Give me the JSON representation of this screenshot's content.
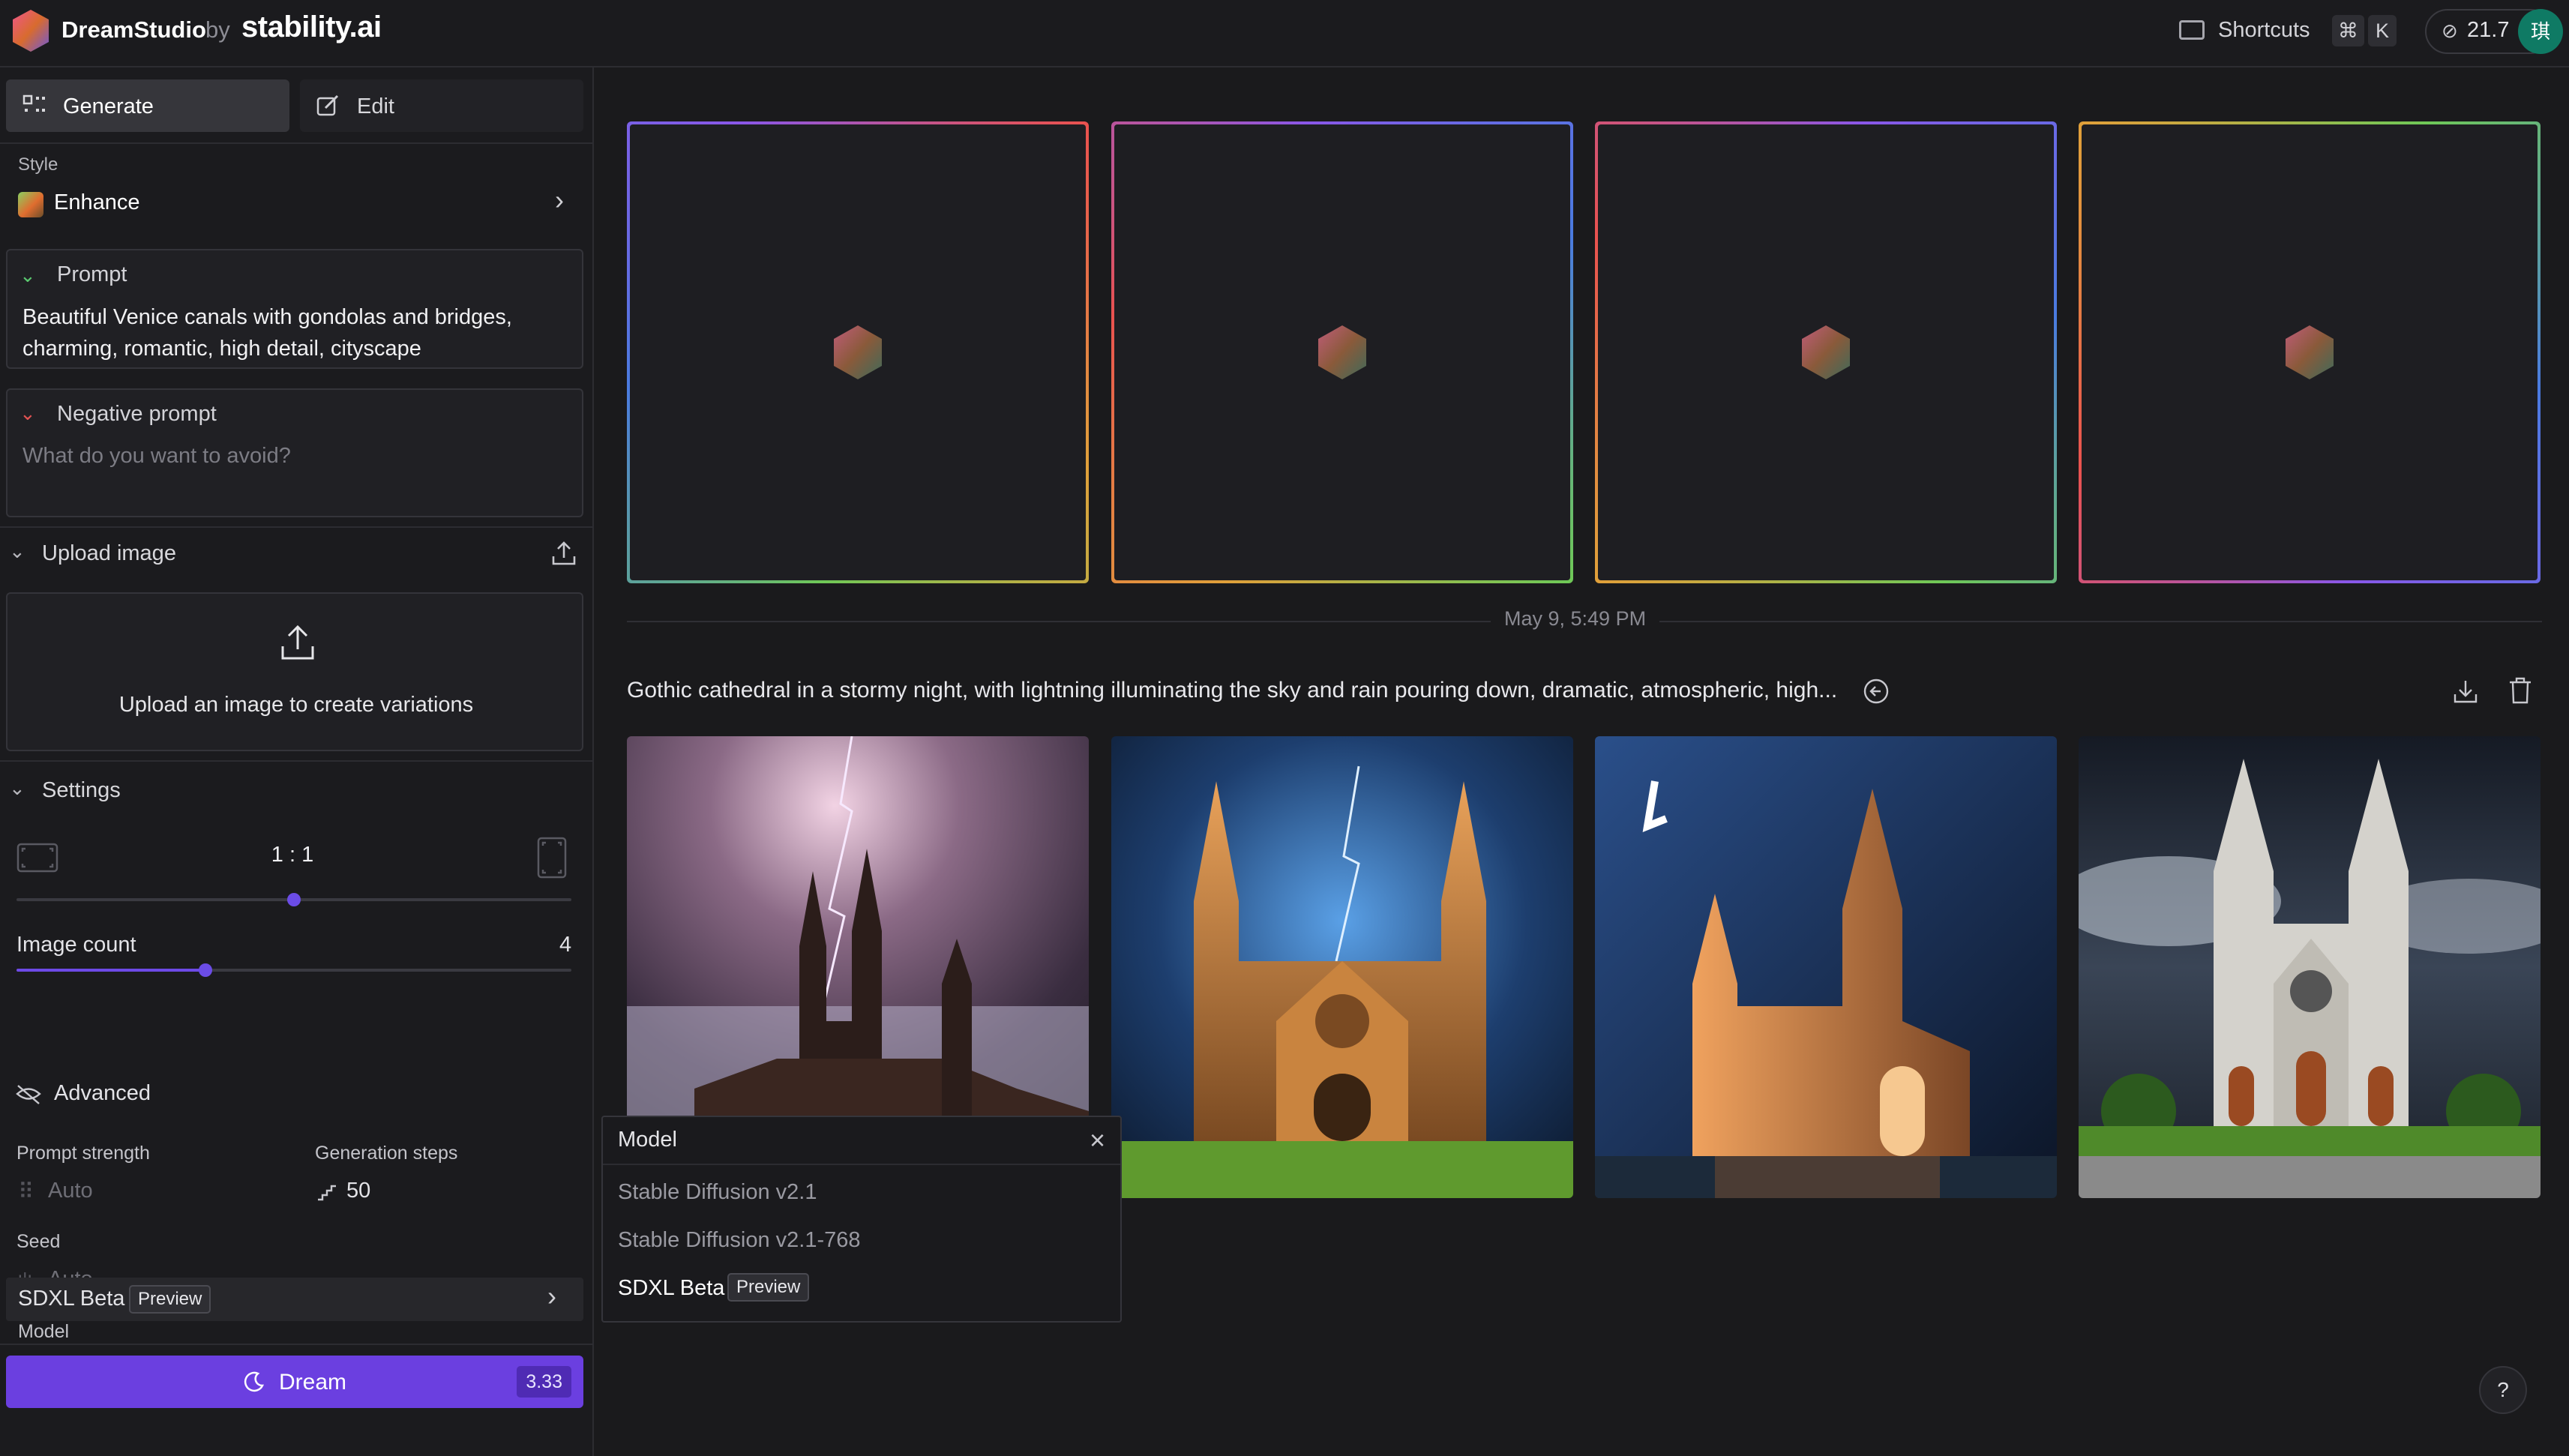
{
  "topbar": {
    "brand": "DreamStudio",
    "by": "by",
    "company": "stability.ai",
    "shortcuts_label": "Shortcuts",
    "shortcut_keys": [
      "⌘",
      "K"
    ],
    "credits": "21.7",
    "avatar_initial": "琪"
  },
  "sidebar": {
    "tabs": [
      {
        "label": "Generate",
        "icon": "grid-icon"
      },
      {
        "label": "Edit",
        "icon": "edit-icon"
      }
    ],
    "style": {
      "label": "Style",
      "value": "Enhance"
    },
    "prompt": {
      "label": "Prompt",
      "text": "Beautiful Venice canals with gondolas and bridges, charming, romantic, high detail, cityscape"
    },
    "negative_prompt": {
      "label": "Negative prompt",
      "placeholder": "What do you want to avoid?"
    },
    "upload": {
      "label": "Upload image",
      "drop_text": "Upload an image to create variations"
    },
    "settings": {
      "label": "Settings",
      "aspect_ratio": "1 : 1",
      "aspect_ratio_slider": 0.5,
      "image_count_label": "Image count",
      "image_count": "4",
      "image_count_slider": 0.34,
      "advanced_label": "Advanced",
      "prompt_strength_label": "Prompt strength",
      "prompt_strength_value": "Auto",
      "generation_steps_label": "Generation steps",
      "generation_steps_value": "50",
      "seed_label": "Seed",
      "seed_value": "Auto",
      "model_label": "Model",
      "model_value": "SDXL Beta",
      "model_badge": "Preview"
    },
    "dream_button": {
      "label": "Dream",
      "cost": "3.33"
    }
  },
  "main": {
    "timestamp": "May 9, 5:49 PM",
    "generation_prompt": "Gothic cathedral in a stormy night, with lightning illuminating the sky and rain pouring down, dramatic, atmospheric, high...",
    "placeholder_count": 4,
    "images": [
      {
        "name": "cathedral-image-1"
      },
      {
        "name": "cathedral-image-2"
      },
      {
        "name": "cathedral-image-3"
      },
      {
        "name": "cathedral-image-4"
      }
    ]
  },
  "model_dropdown": {
    "title": "Model",
    "options": [
      {
        "label": "Stable Diffusion v2.1"
      },
      {
        "label": "Stable Diffusion v2.1-768"
      },
      {
        "label": "SDXL Beta",
        "badge": "Preview",
        "selected": true
      }
    ]
  },
  "help_label": "?",
  "colors": {
    "accent": "#6b3fe0",
    "background": "#1a1a1c",
    "panel": "#1b1b1e"
  }
}
